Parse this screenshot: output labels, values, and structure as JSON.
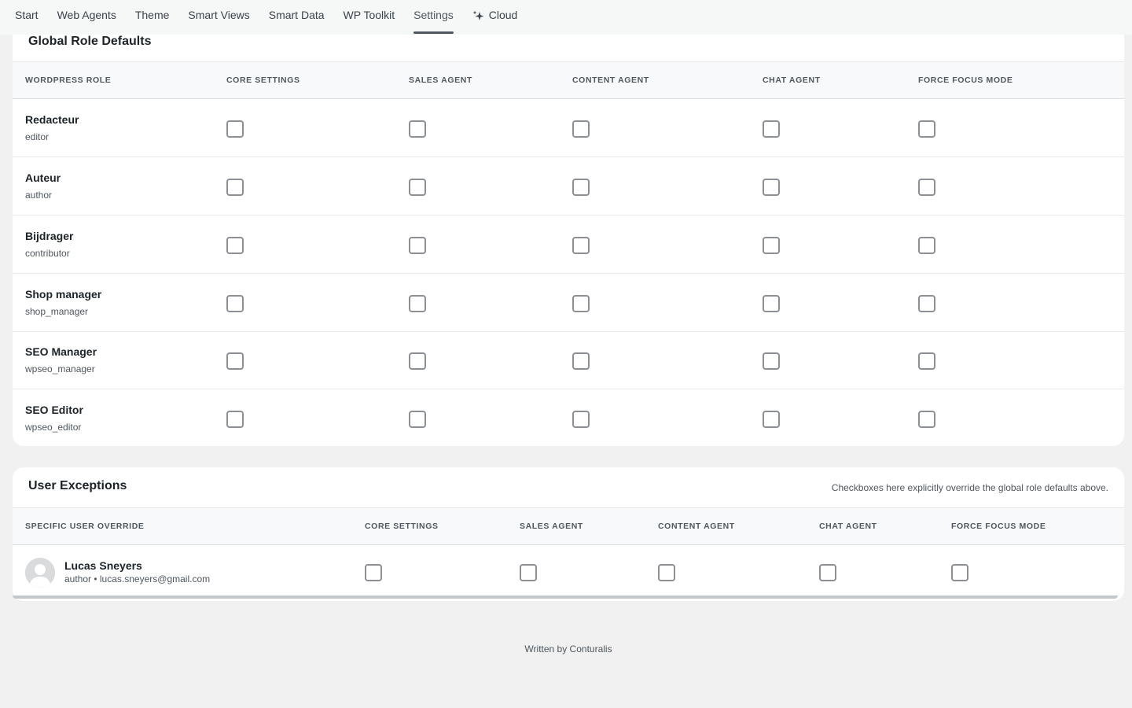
{
  "nav": {
    "items": [
      {
        "label": "Start"
      },
      {
        "label": "Web Agents"
      },
      {
        "label": "Theme"
      },
      {
        "label": "Smart Views"
      },
      {
        "label": "Smart Data"
      },
      {
        "label": "WP Toolkit"
      },
      {
        "label": "Settings",
        "active": true
      },
      {
        "label": "Cloud",
        "icon": "sparkle-icon"
      }
    ]
  },
  "global_roles": {
    "title": "Global Role Defaults",
    "columns": [
      "WORDPRESS ROLE",
      "CORE SETTINGS",
      "SALES AGENT",
      "CONTENT AGENT",
      "CHAT AGENT",
      "FORCE FOCUS MODE"
    ],
    "rows": [
      {
        "name": "Redacteur",
        "slug": "editor"
      },
      {
        "name": "Auteur",
        "slug": "author"
      },
      {
        "name": "Bijdrager",
        "slug": "contributor"
      },
      {
        "name": "Shop manager",
        "slug": "shop_manager"
      },
      {
        "name": "SEO Manager",
        "slug": "wpseo_manager"
      },
      {
        "name": "SEO Editor",
        "slug": "wpseo_editor"
      }
    ]
  },
  "user_exceptions": {
    "title": "User Exceptions",
    "note": "Checkboxes here explicitly override the global role defaults above.",
    "columns": [
      "SPECIFIC USER OVERRIDE",
      "CORE SETTINGS",
      "SALES AGENT",
      "CONTENT AGENT",
      "CHAT AGENT",
      "FORCE FOCUS MODE"
    ],
    "users": [
      {
        "name": "Lucas Sneyers",
        "meta": "author • lucas.sneyers@gmail.com"
      }
    ]
  },
  "footer": {
    "text": "Written by Conturalis"
  },
  "colors": {
    "background": "#f0f1f0",
    "card": "#ffffff",
    "checkbox_border": "#8c8f94",
    "text_muted": "#50575e"
  }
}
